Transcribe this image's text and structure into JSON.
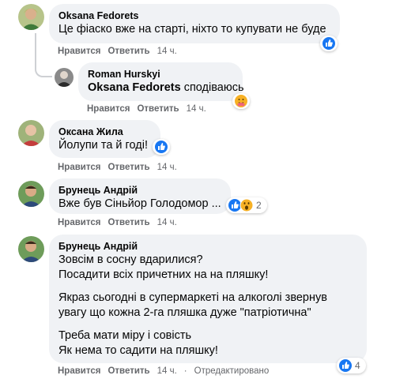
{
  "comments": [
    {
      "author": "Oksana Fedorets",
      "lines": [
        "Це фіаско вже на старті, ніхто то купувати не буде"
      ],
      "like": "Нравится",
      "reply": "Ответить",
      "time": "14 ч.",
      "reaction_icons": [
        "like-icon"
      ],
      "reaction_count": ""
    },
    {
      "author": "Roman Hurskyi",
      "mention": "Oksana Fedorets",
      "text": " сподіваюсь",
      "like": "Нравится",
      "reply": "Ответить",
      "time": "14 ч.",
      "reaction_icons": [
        "care-icon"
      ],
      "reaction_count": ""
    },
    {
      "author": "Оксана Жила",
      "lines": [
        "Йолупи та й годі!"
      ],
      "like": "Нравится",
      "reply": "Ответить",
      "time": "14 ч.",
      "reaction_icons": [
        "like-icon"
      ],
      "reaction_count": ""
    },
    {
      "author": "Брунець Андрій",
      "lines": [
        "Вже був Сіньйор Голодомор ..."
      ],
      "like": "Нравится",
      "reply": "Ответить",
      "time": "14 ч.",
      "reaction_icons": [
        "like-icon",
        "wow-icon"
      ],
      "reaction_count": "2"
    },
    {
      "author": "Брунець Андрій",
      "lines": [
        "Зовсім в сосну вдарилися?",
        "Посадити всіх причетних на на пляшку!",
        "",
        "Якраз сьогодні в супермаркеті на алкоголі звернув",
        "увагу що кожна 2-га пляшка дуже \"патріотична\"",
        "",
        "Треба мати міру і совість",
        "Як нема то садити на пляшку!"
      ],
      "like": "Нравится",
      "reply": "Ответить",
      "time": "14 ч.",
      "edited": "Отредактировано",
      "reaction_icons": [
        "like-icon"
      ],
      "reaction_count": "4"
    }
  ],
  "colors": {
    "bubble": "#f0f2f5",
    "meta_text": "#65676b",
    "like_blue": "#1877f2",
    "wow_yellow": "#f7b125"
  }
}
